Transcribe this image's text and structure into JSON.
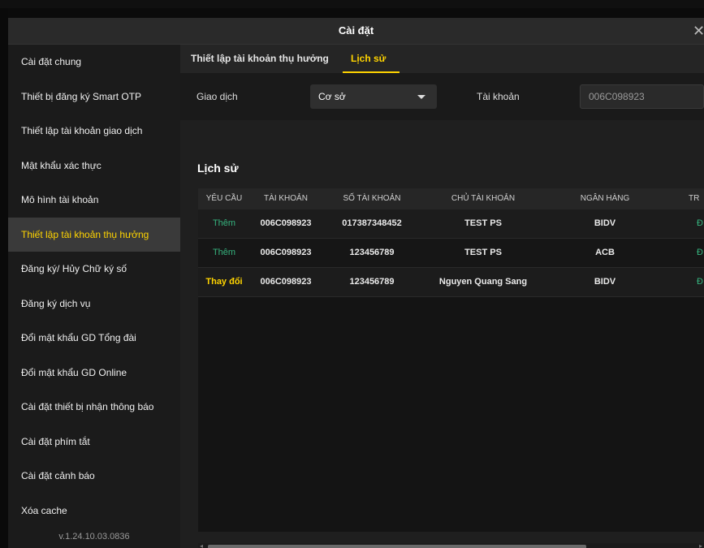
{
  "modal": {
    "title": "Cài đặt",
    "close_glyph": "✕"
  },
  "sidebar": {
    "items": [
      {
        "label": "Cài đặt chung"
      },
      {
        "label": "Thiết bị đăng ký Smart OTP"
      },
      {
        "label": "Thiết lập tài khoản giao dịch"
      },
      {
        "label": "Mật khẩu xác thực"
      },
      {
        "label": "Mô hình tài khoản"
      },
      {
        "label": "Thiết lập tài khoản thụ hưởng",
        "active": true
      },
      {
        "label": "Đăng ký/ Hủy Chữ ký số"
      },
      {
        "label": "Đăng ký dịch vụ"
      },
      {
        "label": "Đổi mật khẩu GD Tổng đài"
      },
      {
        "label": "Đổi mật khẩu GD Online"
      },
      {
        "label": "Cài đặt thiết bị nhận thông báo"
      },
      {
        "label": "Cài đặt phím tắt"
      },
      {
        "label": "Cài đặt cảnh báo"
      },
      {
        "label": "Xóa cache"
      }
    ],
    "version": "v.1.24.10.03.0836"
  },
  "tabs": [
    {
      "label": "Thiết lập tài khoản thụ hưởng"
    },
    {
      "label": "Lịch sử",
      "active": true
    }
  ],
  "filters": {
    "transaction_label": "Giao dịch",
    "transaction_value": "Cơ sở",
    "account_label": "Tài khoản",
    "account_value": "006C098923"
  },
  "history": {
    "title": "Lịch sử",
    "columns": [
      "YÊU CẦU",
      "TÀI KHOẢN",
      "SỐ TÀI KHOẢN",
      "CHỦ TÀI KHOẢN",
      "NGÂN HÀNG",
      "TR"
    ],
    "rows": [
      {
        "request": "Thêm",
        "account": "006C098923",
        "bank_account_no": "017387348452",
        "holder": "TEST PS",
        "bank": "BIDV",
        "status_partial": "Đ"
      },
      {
        "request": "Thêm",
        "account": "006C098923",
        "bank_account_no": "123456789",
        "holder": "TEST PS",
        "bank": "ACB",
        "status_partial": "Đ"
      },
      {
        "request": "Thay đổi",
        "account": "006C098923",
        "bank_account_no": "123456789",
        "holder": "Nguyen Quang Sang",
        "bank": "BIDV",
        "status_partial": "Đ"
      }
    ]
  },
  "colors": {
    "accent": "#ffd400",
    "success": "#36b37e",
    "panel": "#1f1f1f"
  },
  "icons": {
    "close": "close-icon",
    "caret": "chevron-down-icon"
  }
}
